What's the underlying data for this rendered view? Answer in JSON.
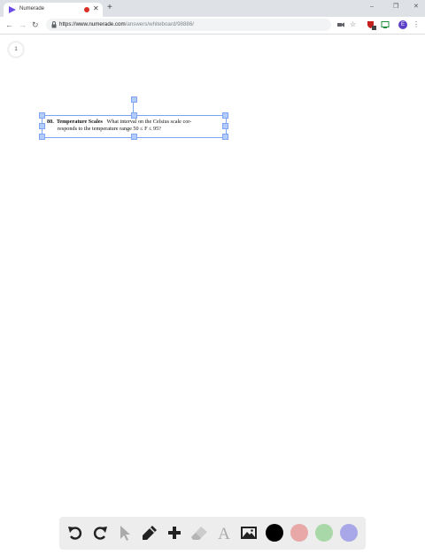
{
  "browser": {
    "tab_title": "Numerade",
    "new_tab_symbol": "+",
    "tab_close_symbol": "✕",
    "url_host": "https://www.numerade.com",
    "url_path": "/answers/whiteboard/98886/",
    "profile_initial": "E",
    "window_controls": [
      "–",
      "❐",
      "✕"
    ]
  },
  "whiteboard": {
    "page_number": "1",
    "problem": {
      "number": "80.",
      "heading": "Temperature Scales",
      "line1": "What interval on the Celsius scale cor-",
      "line2": "responds to the temperature range 50 ≤ F ≤ 95?"
    }
  },
  "palette": {
    "tools": [
      "undo-icon",
      "redo-icon",
      "pointer-icon",
      "pencil-icon",
      "add-icon",
      "eraser-icon",
      "text-icon",
      "image-icon"
    ],
    "colors": {
      "black": "#000000",
      "red": "#e8a8a8",
      "green": "#a8d8a8",
      "blue": "#a8a8e8"
    },
    "accent": "#7ea4f5"
  }
}
